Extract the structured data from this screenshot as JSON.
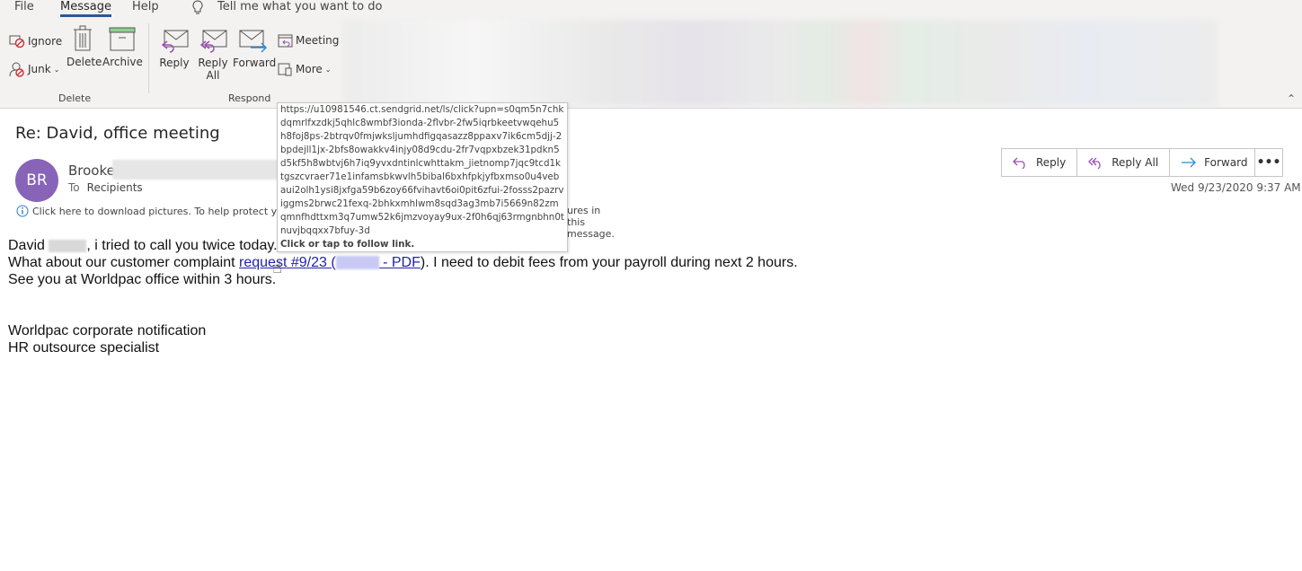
{
  "menubar": {
    "tabs": [
      "File",
      "Message",
      "Help"
    ],
    "active_tab": "Message",
    "tell_me": "Tell me what you want to do"
  },
  "ribbon": {
    "delete_group": {
      "label": "Delete",
      "ignore": "Ignore",
      "junk": "Junk",
      "delete": "Delete",
      "archive": "Archive"
    },
    "respond_group": {
      "label": "Respond",
      "reply": "Reply",
      "reply_all_line1": "Reply",
      "reply_all_line2": "All",
      "forward": "Forward",
      "meeting": "Meeting",
      "more": "More"
    },
    "colors": {
      "archive_lid": "#8fd18f",
      "reply_arrow": "#9b4fb5",
      "forward_arrow": "#2a8dd4"
    }
  },
  "message": {
    "subject": "Re: David, office meeting",
    "avatar_initials": "BR",
    "avatar_color": "#8764b8",
    "sender": "Brooke",
    "to_label": "To",
    "to_value": "Recipients",
    "info_text": "Click here to download pictures. To help protect you",
    "info_text_end": "ures in this message.",
    "date": "Wed 9/23/2020 9:37 AM",
    "actions": {
      "reply": "Reply",
      "reply_all": "Reply All",
      "forward": "Forward",
      "more": "•••"
    }
  },
  "body": {
    "line1_a": "David ",
    "line1_b": ", i tried to call you twice today.",
    "line2_a": "What about our customer complaint ",
    "link_text_a": "request #9/23 (",
    "link_text_b": " - PDF",
    "line2_b": "). I need to debit fees from your payroll during next 2 hours.",
    "line3": "See you at Worldpac office within 3 hours.",
    "sig1": "Worldpac corporate notification",
    "sig2": "HR outsource specialist"
  },
  "tooltip": {
    "url": "https://u10981546.ct.sendgrid.net/ls/click?upn=s0qm5n7chkdqmrlfxzdkj5qhlc8wmbf3ionda-2flvbr-2fw5iqrbkeetvwqehu5h8foj8ps-2btrqv0fmjwksljumhdfigqasazz8ppaxv7ik6cm5djj-2bpdejll1jx-2bfs8owakkv4injy08d9cdu-2fr7vqpxbzek31pdkn5d5kf5h8wbtvj6h7iq9yvxdntinlcwhttakm_jietnomp7jqc9tcd1ktgszcvraer71e1infamsbkwvlh5bibal6bxhfpkjyfbxmso0u4vebaui2olh1ysi8jxfga59b6zoy66fvihavt6oi0pit6zfui-2fosss2pazrviggms2brwc21fexq-2bhkxmhlwm8sqd3ag3mb7i5669n82zmqmnfhdttxm3q7umw52k6jmzvoyay9ux-2f0h6qj63rmgnbhn0tnuvjbqqxx7bfuy-3d",
    "hint": "Click or tap to follow link."
  }
}
